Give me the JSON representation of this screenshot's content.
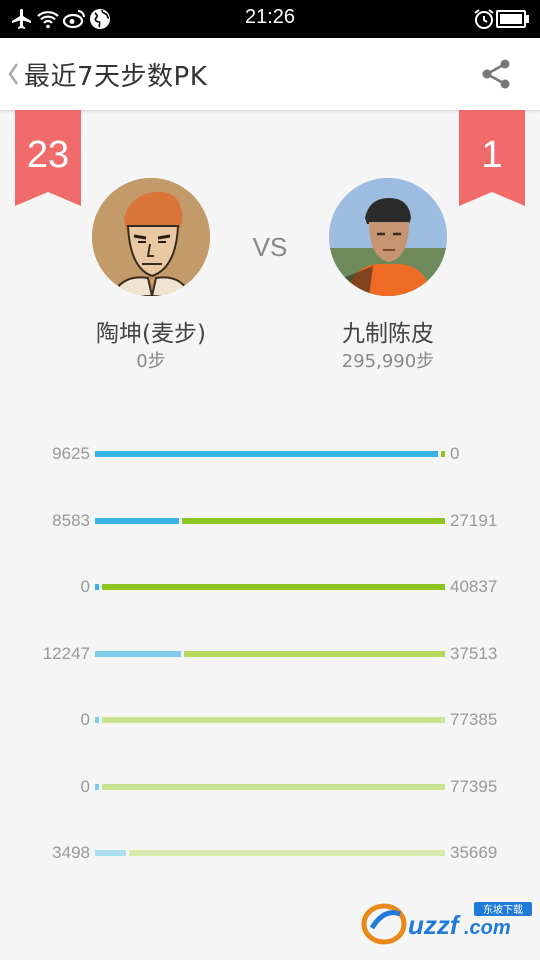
{
  "status_bar": {
    "time": "21:26",
    "icons": [
      "airplane-icon",
      "wifi-icon",
      "weibo-icon",
      "globe-icon",
      "alarm-icon",
      "battery-icon"
    ]
  },
  "header": {
    "title": "最近7天步数PK",
    "back_icon": "chevron-left-icon",
    "share_icon": "share-icon"
  },
  "left_player": {
    "rank": "23",
    "name": "陶坤(麦步)",
    "steps": "0步"
  },
  "vs_label": "VS",
  "right_player": {
    "rank": "1",
    "name": "九制陈皮",
    "steps": "295,990步"
  },
  "colors": {
    "rank_ribbon": "#f26b6b",
    "left_bars": [
      "#3ab3e5",
      "#3ab3e5",
      "#3ab3e5",
      "#7fcbea",
      "#7fcbea",
      "#7fcbea",
      "#a9dcef"
    ],
    "right_bars": [
      "#8cc420",
      "#8cc420",
      "#8cc420",
      "#b7da5e",
      "#c9e38e",
      "#c9e38e",
      "#d6eaab"
    ]
  },
  "daily": [
    {
      "left": "9625",
      "right": "0",
      "left_frac": 1.0
    },
    {
      "left": "8583",
      "right": "27191",
      "left_frac": 0.24
    },
    {
      "left": "0",
      "right": "40837",
      "left_frac": 0.0
    },
    {
      "left": "12247",
      "right": "37513",
      "left_frac": 0.246
    },
    {
      "left": "0",
      "right": "77385",
      "left_frac": 0.0
    },
    {
      "left": "0",
      "right": "77395",
      "left_frac": 0.0
    },
    {
      "left": "3498",
      "right": "35669",
      "left_frac": 0.089
    }
  ],
  "watermark": {
    "brand": "uzzf.com",
    "tag": "东坡下载"
  }
}
